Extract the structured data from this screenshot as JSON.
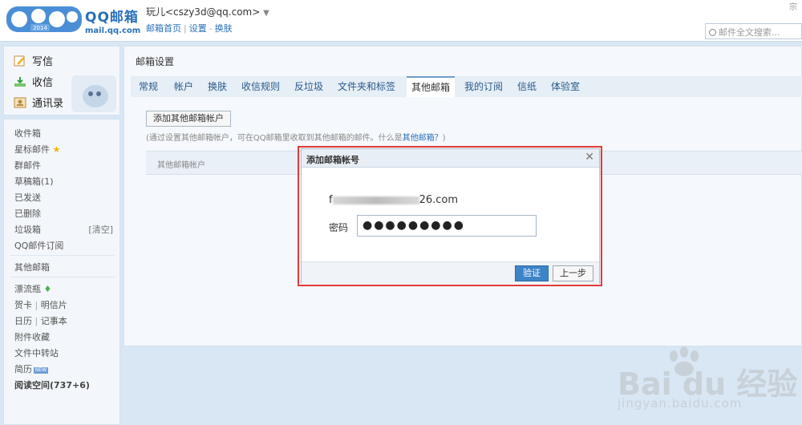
{
  "header": {
    "brand_title": "QQ邮箱",
    "brand_domain": "mail.qq.com",
    "logo_badge": "2014",
    "user_name": "玩儿<cszy3d@qq.com>",
    "links": [
      "邮箱首页",
      "设置",
      "换肤"
    ],
    "search_placeholder": "邮件全文搜索...",
    "corner": "宗"
  },
  "sidebar": {
    "compose": "写信",
    "receive": "收信",
    "contacts": "通讯录",
    "folders": [
      "收件箱",
      "星标邮件",
      "群邮件",
      "草稿箱(1)",
      "已发送",
      "已删除",
      "垃圾箱",
      "QQ邮件订阅"
    ],
    "trash_clear": "[清空]",
    "other_mail": "其他邮箱",
    "apps": [
      "漂流瓶",
      "贺卡",
      "明信片",
      "日历",
      "记事本",
      "附件收藏",
      "文件中转站",
      "简历"
    ],
    "new_badge": "NEW",
    "reading": "阅读空间(737+6)"
  },
  "main": {
    "title": "邮箱设置",
    "tabs": [
      "常规",
      "帐户",
      "换肤",
      "收信规则",
      "反垃圾",
      "文件夹和标签",
      "其他邮箱",
      "我的订阅",
      "信纸",
      "体验室"
    ],
    "active_tab": "其他邮箱",
    "add_button": "添加其他邮箱帐户",
    "hint_prefix": "(通过设置其他邮箱帐户，可在QQ邮箱里收取到其他邮箱的邮件。什么是",
    "hint_link": "其他邮箱？",
    "hint_suffix": ")",
    "table_header": "其他邮箱帐户"
  },
  "modal": {
    "title": "添加邮箱帐号",
    "email_start": "f",
    "email_end": "26.com",
    "password_label": "密码",
    "password_value": "●●●●●●●●●",
    "verify_button": "验证",
    "back_button": "上一步"
  },
  "watermark": {
    "text": "Bai du 经验",
    "sub": "jingyan.baidu.com"
  }
}
